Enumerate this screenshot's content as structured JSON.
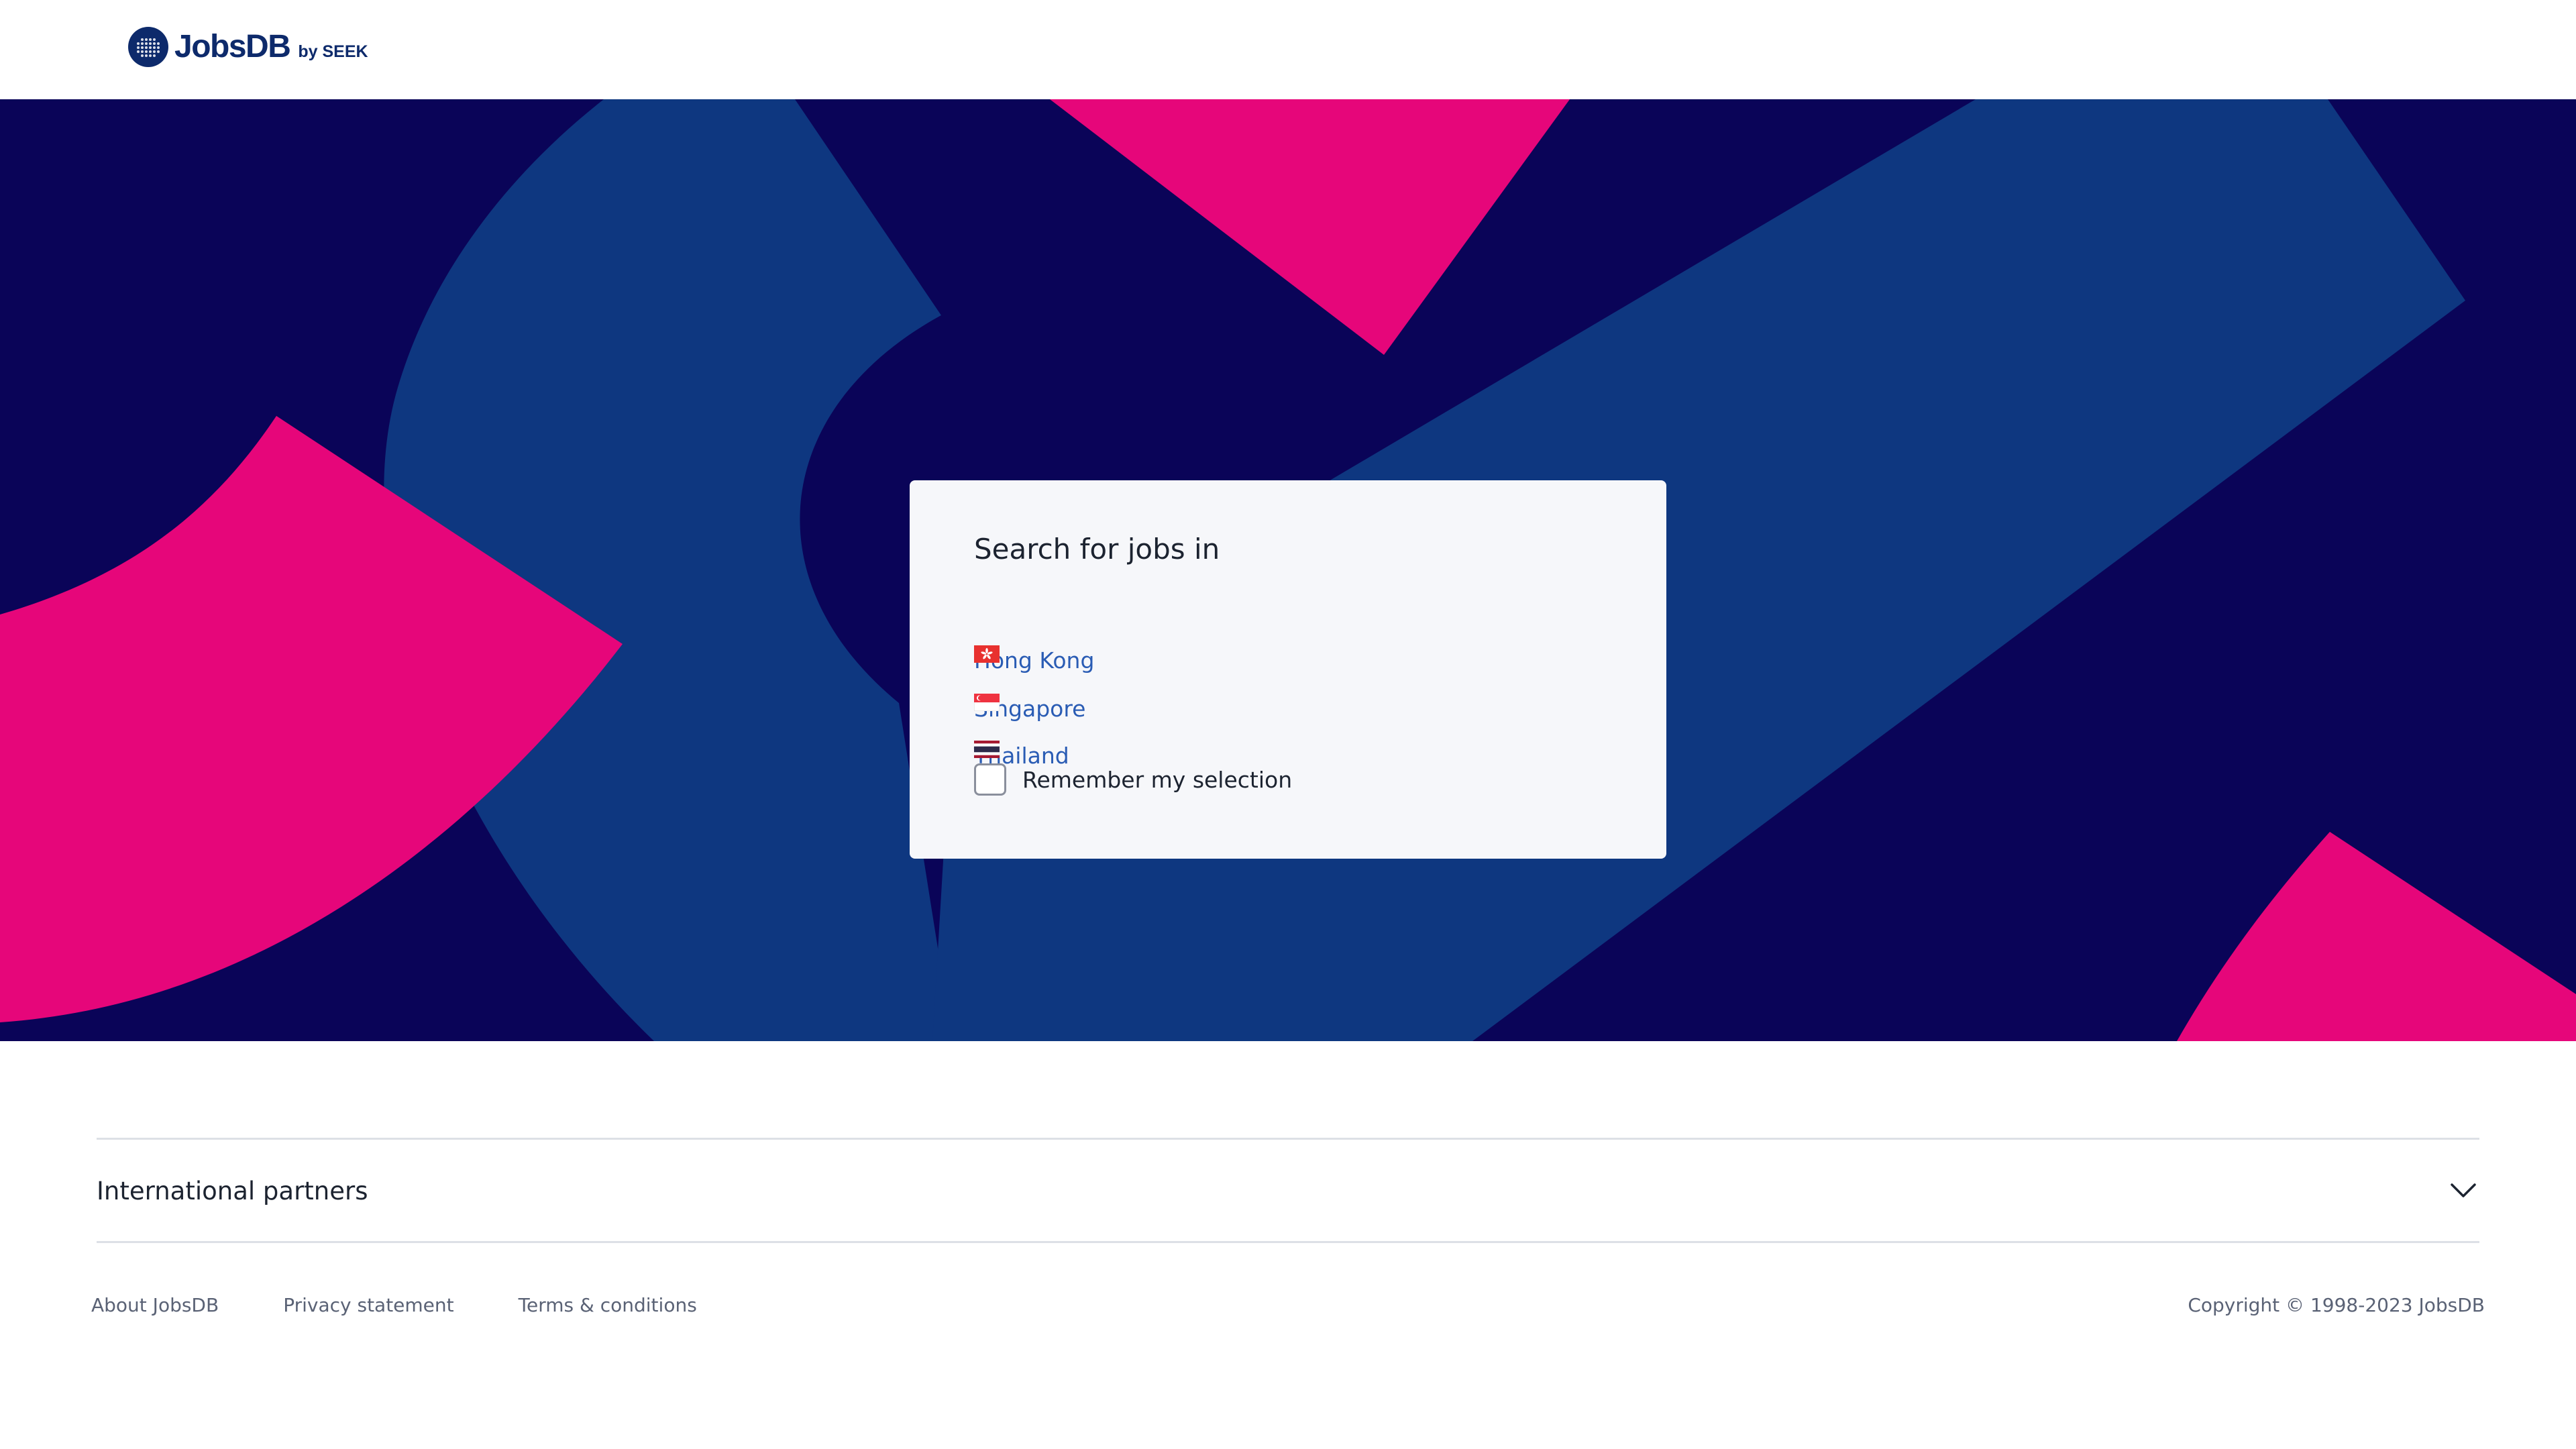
{
  "header": {
    "logo_text": "JobsDB",
    "logo_byline": "by SEEK"
  },
  "colors": {
    "hero_background": "#0a0458",
    "hero_blue": "#0e3780",
    "hero_pink": "#e6067a",
    "link": "#2a5cb4"
  },
  "card": {
    "title": "Search for jobs in",
    "countries": [
      {
        "label": "Hong Kong",
        "flag_icon": "hong-kong-flag-icon"
      },
      {
        "label": "Singapore",
        "flag_icon": "singapore-flag-icon"
      },
      {
        "label": "Thailand",
        "flag_icon": "thailand-flag-icon"
      }
    ],
    "remember_label": "Remember my selection",
    "remember_checked": false
  },
  "footer": {
    "partners_label": "International partners",
    "partners_icon": "chevron-down-icon",
    "links": [
      "About JobsDB",
      "Privacy statement",
      "Terms & conditions"
    ],
    "copyright": "Copyright © 1998-2023 JobsDB"
  }
}
